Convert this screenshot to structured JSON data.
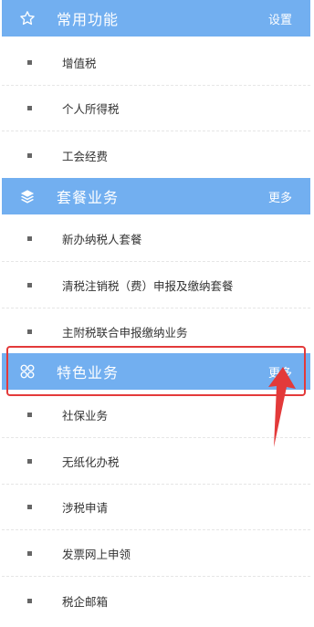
{
  "sections": [
    {
      "title": "常用功能",
      "icon": "star-icon",
      "action": "设置",
      "items": [
        "增值税",
        "个人所得税",
        "工会经费"
      ]
    },
    {
      "title": "套餐业务",
      "icon": "layers-icon",
      "action": "更多",
      "items": [
        "新办纳税人套餐",
        "清税注销税（费）申报及缴纳套餐",
        "主附税联合申报缴纳业务"
      ]
    },
    {
      "title": "特色业务",
      "icon": "four-circles-icon",
      "action": "更多",
      "items": [
        "社保业务",
        "无纸化办税",
        "涉税申请",
        "发票网上申领",
        "税企邮箱"
      ]
    }
  ],
  "colors": {
    "header_bg": "#72aff0",
    "highlight": "#e33a3a"
  }
}
